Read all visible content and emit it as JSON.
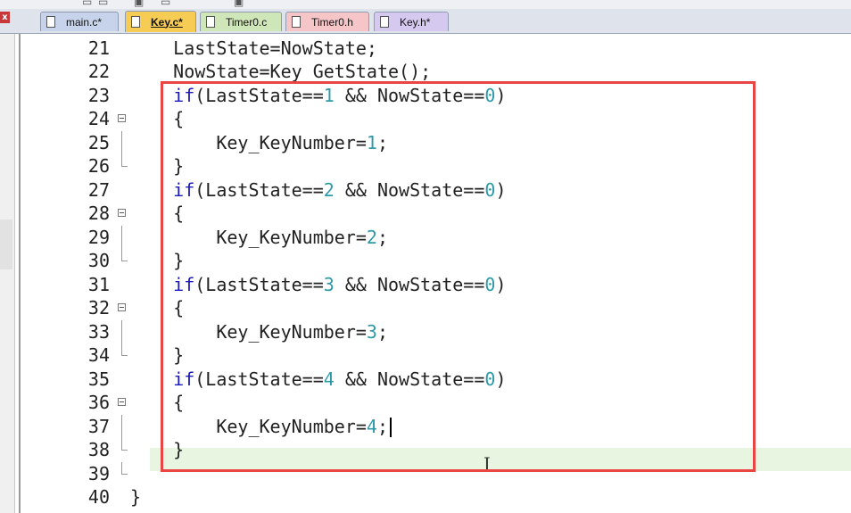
{
  "tabs": [
    {
      "label": "main.c*",
      "active": false,
      "color": "#c7d3ea"
    },
    {
      "label": "Key.c*",
      "active": true,
      "color": "#f6cc55"
    },
    {
      "label": "Timer0.c",
      "active": false,
      "color": "#cfe6b8"
    },
    {
      "label": "Timer0.h",
      "active": false,
      "color": "#f5c5c8"
    },
    {
      "label": "Key.h*",
      "active": false,
      "color": "#d6c9ef"
    }
  ],
  "close_glyph": "x",
  "ibeam_glyph": "I",
  "highlight_box_color": "#e94545",
  "editor": {
    "current_line": "37",
    "lines": [
      {
        "n": "21",
        "text": "    LastState=NowState;"
      },
      {
        "n": "22",
        "text": "    NowState=Key_GetState();"
      },
      {
        "n": "23",
        "text": "    if(LastState==1 && NowState==0)"
      },
      {
        "n": "24",
        "text": "    {"
      },
      {
        "n": "25",
        "text": "        Key_KeyNumber=1;"
      },
      {
        "n": "26",
        "text": "    }"
      },
      {
        "n": "27",
        "text": "    if(LastState==2 && NowState==0)"
      },
      {
        "n": "28",
        "text": "    {"
      },
      {
        "n": "29",
        "text": "        Key_KeyNumber=2;"
      },
      {
        "n": "30",
        "text": "    }"
      },
      {
        "n": "31",
        "text": "    if(LastState==3 && NowState==0)"
      },
      {
        "n": "32",
        "text": "    {"
      },
      {
        "n": "33",
        "text": "        Key_KeyNumber=3;"
      },
      {
        "n": "34",
        "text": "    }"
      },
      {
        "n": "35",
        "text": "    if(LastState==4 && NowState==0)"
      },
      {
        "n": "36",
        "text": "    {"
      },
      {
        "n": "37",
        "text": "        Key_KeyNumber=4;"
      },
      {
        "n": "38",
        "text": "    }"
      },
      {
        "n": "39",
        "text": ""
      },
      {
        "n": "40",
        "text": "}"
      }
    ]
  }
}
